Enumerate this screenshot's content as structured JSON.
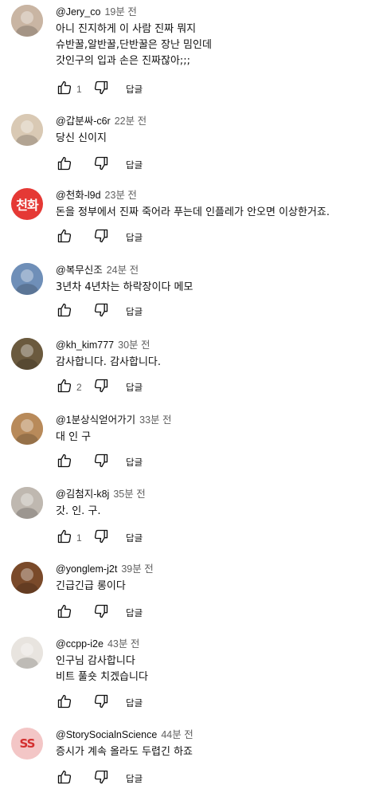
{
  "comments": [
    {
      "author": "@Jery_co",
      "time": "19분 전",
      "text": "아니 진지하게 이 사람 진짜 뭐지\n슈반꿀,알반꿀,단반꿀은 장난 밈인데\n갓인구의 입과 손은 진짜잖아;;;",
      "likes": "1",
      "reply": "답글",
      "avatar": {
        "type": "image",
        "color": "#c9b5a3"
      }
    },
    {
      "author": "@갑분싸-c6r",
      "time": "22분 전",
      "text": "당신 신이지",
      "likes": "",
      "reply": "답글",
      "avatar": {
        "type": "image",
        "color": "#d9c9b4"
      }
    },
    {
      "author": "@천화-l9d",
      "time": "23분 전",
      "text": "돈을 정부에서 진짜 죽어라 푸는데 인플레가 안오면 이상한거죠.",
      "likes": "",
      "reply": "답글",
      "avatar": {
        "type": "text",
        "label": "천화",
        "color": "#e53935"
      }
    },
    {
      "author": "@복무신조",
      "time": "24분 전",
      "text": "3년차 4년차는 하락장이다 메모",
      "likes": "",
      "reply": "답글",
      "avatar": {
        "type": "image",
        "color": "#6f8fb8"
      }
    },
    {
      "author": "@kh_kim777",
      "time": "30분 전",
      "text": "감사합니다. 감사합니다.",
      "likes": "2",
      "reply": "답글",
      "avatar": {
        "type": "image",
        "color": "#6b5a3e"
      }
    },
    {
      "author": "@1분상식얻어가기",
      "time": "33분 전",
      "text": "대 인 구",
      "likes": "",
      "reply": "답글",
      "avatar": {
        "type": "image",
        "color": "#b88a5a"
      }
    },
    {
      "author": "@김첨지-k8j",
      "time": "35분 전",
      "text": "갓. 인. 구.",
      "likes": "1",
      "reply": "답글",
      "avatar": {
        "type": "image",
        "color": "#bfb8b0"
      }
    },
    {
      "author": "@yonglem-j2t",
      "time": "39분 전",
      "text": "긴급긴급 롱이다",
      "likes": "",
      "reply": "답글",
      "avatar": {
        "type": "image",
        "color": "#7a4a2a"
      }
    },
    {
      "author": "@ccpp-i2e",
      "time": "43분 전",
      "text": "인구님 감사합니다\n비트 풀숏 치겠습니다",
      "likes": "",
      "reply": "답글",
      "avatar": {
        "type": "image",
        "color": "#e8e4df"
      }
    },
    {
      "author": "@StorySocialnScience",
      "time": "44분 전",
      "text": "증시가 계속 올라도 두렵긴 하죠",
      "likes": "",
      "reply": "답글",
      "avatar": {
        "type": "text",
        "label": "SS",
        "color": "#f3c6c6"
      }
    }
  ]
}
